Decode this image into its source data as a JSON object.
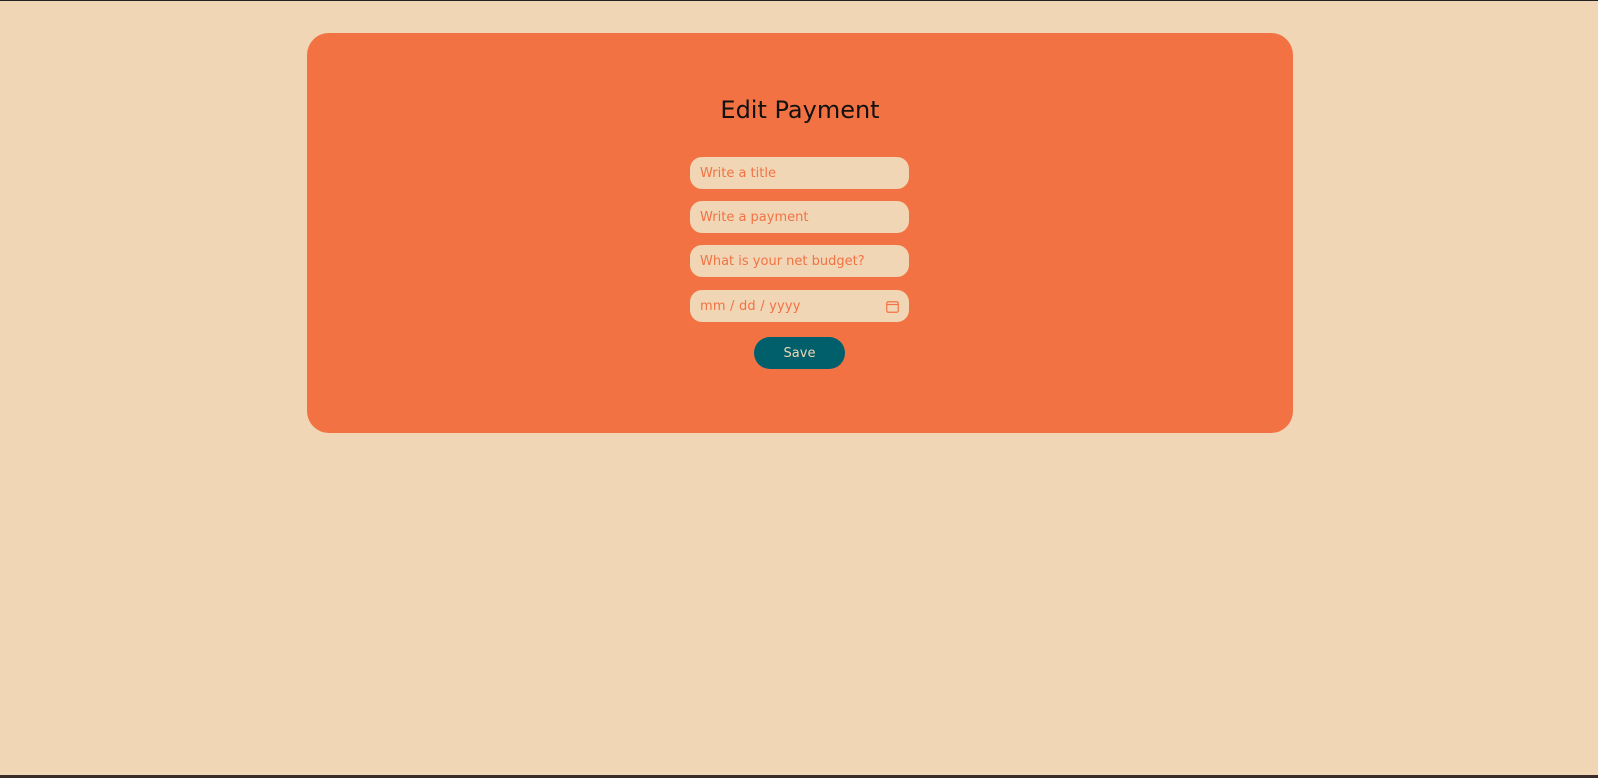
{
  "form": {
    "title": "Edit Payment",
    "fields": {
      "title_placeholder": "Write a title",
      "payment_placeholder": "Write a payment",
      "budget_placeholder": "What is your net budget?",
      "date_placeholder": "mm / dd / yyyy"
    },
    "save_label": "Save"
  },
  "icons": {
    "calendar": "calendar-icon"
  },
  "colors": {
    "background": "#f1d6b6",
    "card": "#f27243",
    "button": "#005f6b",
    "placeholder": "#f27243",
    "title": "#111111"
  }
}
